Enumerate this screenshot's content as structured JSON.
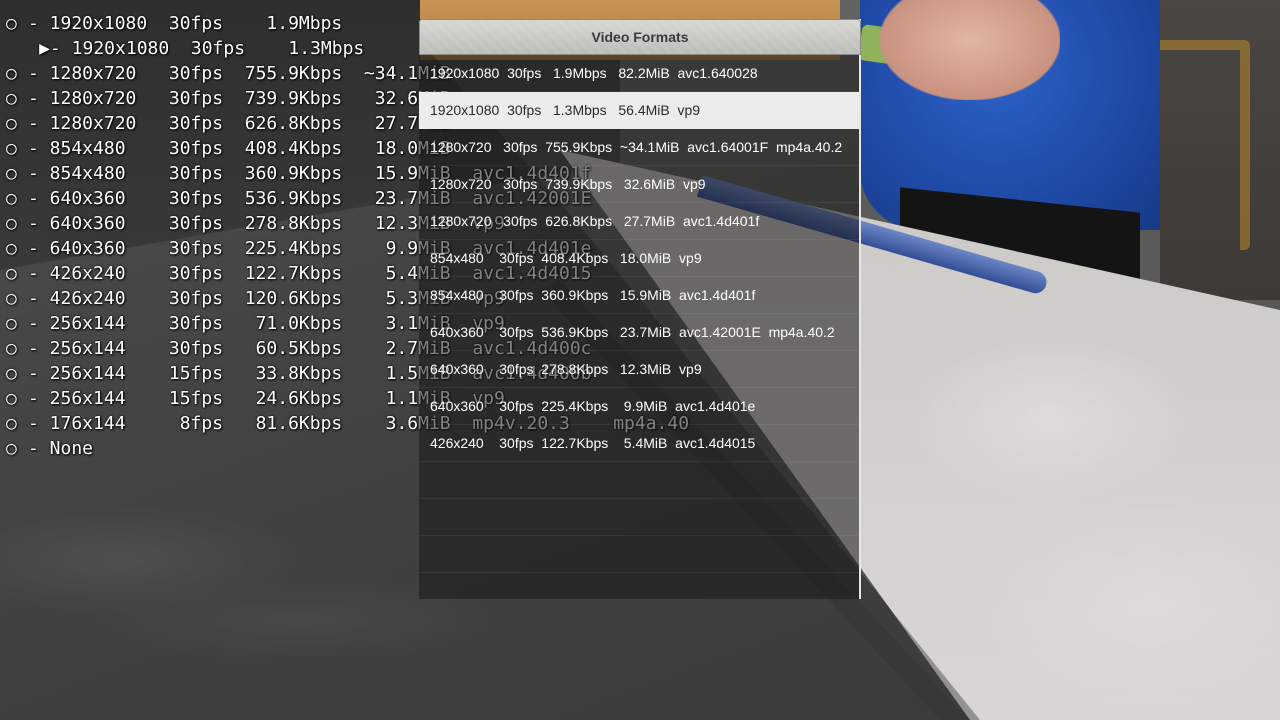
{
  "osd_list": {
    "selected_marker": "▶",
    "unselected_marker": "○",
    "rows": [
      {
        "text": "- 1920x1080  30fps    1.9Mbps",
        "selected": false
      },
      {
        "text": "- 1920x1080  30fps    1.3Mbps",
        "selected": true
      },
      {
        "text": "- 1280x720   30fps  755.9Kbps  ~34.1MiB",
        "selected": false
      },
      {
        "text": "- 1280x720   30fps  739.9Kbps   32.6MiB",
        "selected": false
      },
      {
        "text": "- 1280x720   30fps  626.8Kbps   27.7MiB",
        "selected": false
      },
      {
        "text": "- 854x480    30fps  408.4Kbps   18.0MiB",
        "selected": false
      },
      {
        "text": "- 854x480    30fps  360.9Kbps   15.9MiB  avc1.4d401f",
        "selected": false
      },
      {
        "text": "- 640x360    30fps  536.9Kbps   23.7MiB  avc1.42001E",
        "selected": false
      },
      {
        "text": "- 640x360    30fps  278.8Kbps   12.3MiB  vp9",
        "selected": false
      },
      {
        "text": "- 640x360    30fps  225.4Kbps    9.9MiB  avc1.4d401e",
        "selected": false
      },
      {
        "text": "- 426x240    30fps  122.7Kbps    5.4MiB  avc1.4d4015",
        "selected": false
      },
      {
        "text": "- 426x240    30fps  120.6Kbps    5.3MiB  vp9",
        "selected": false
      },
      {
        "text": "- 256x144    30fps   71.0Kbps    3.1MiB  vp9",
        "selected": false
      },
      {
        "text": "- 256x144    30fps   60.5Kbps    2.7MiB  avc1.4d400c",
        "selected": false
      },
      {
        "text": "- 256x144    15fps   33.8Kbps    1.5MiB  avc1.4d400b",
        "selected": false
      },
      {
        "text": "- 256x144    15fps   24.6Kbps    1.1MiB  vp9",
        "selected": false
      },
      {
        "text": "- 176x144     8fps   81.6Kbps    3.6MiB  mp4v.20.3    mp4a.40",
        "selected": false
      },
      {
        "text": "- None",
        "selected": false
      }
    ]
  },
  "menu": {
    "title": "Video Formats",
    "items": [
      {
        "text": "1920x1080  30fps   1.9Mbps   82.2MiB  avc1.640028",
        "selected": false
      },
      {
        "text": "1920x1080  30fps   1.3Mbps   56.4MiB  vp9",
        "selected": true
      },
      {
        "text": "1280x720   30fps  755.9Kbps  ~34.1MiB  avc1.64001F  mp4a.40.2",
        "selected": false
      },
      {
        "text": "1280x720   30fps  739.9Kbps   32.6MiB  vp9",
        "selected": false
      },
      {
        "text": "1280x720   30fps  626.8Kbps   27.7MiB  avc1.4d401f",
        "selected": false
      },
      {
        "text": "854x480    30fps  408.4Kbps   18.0MiB  vp9",
        "selected": false
      },
      {
        "text": "854x480    30fps  360.9Kbps   15.9MiB  avc1.4d401f",
        "selected": false
      },
      {
        "text": "640x360    30fps  536.9Kbps   23.7MiB  avc1.42001E  mp4a.40.2",
        "selected": false
      },
      {
        "text": "640x360    30fps  278.8Kbps   12.3MiB  vp9",
        "selected": false
      },
      {
        "text": "640x360    30fps  225.4Kbps    9.9MiB  avc1.4d401e",
        "selected": false
      },
      {
        "text": "426x240    30fps  122.7Kbps    5.4MiB  avc1.4d4015",
        "selected": false
      },
      {
        "text": "",
        "selected": false
      },
      {
        "text": "",
        "selected": false
      },
      {
        "text": "",
        "selected": false
      }
    ]
  }
}
